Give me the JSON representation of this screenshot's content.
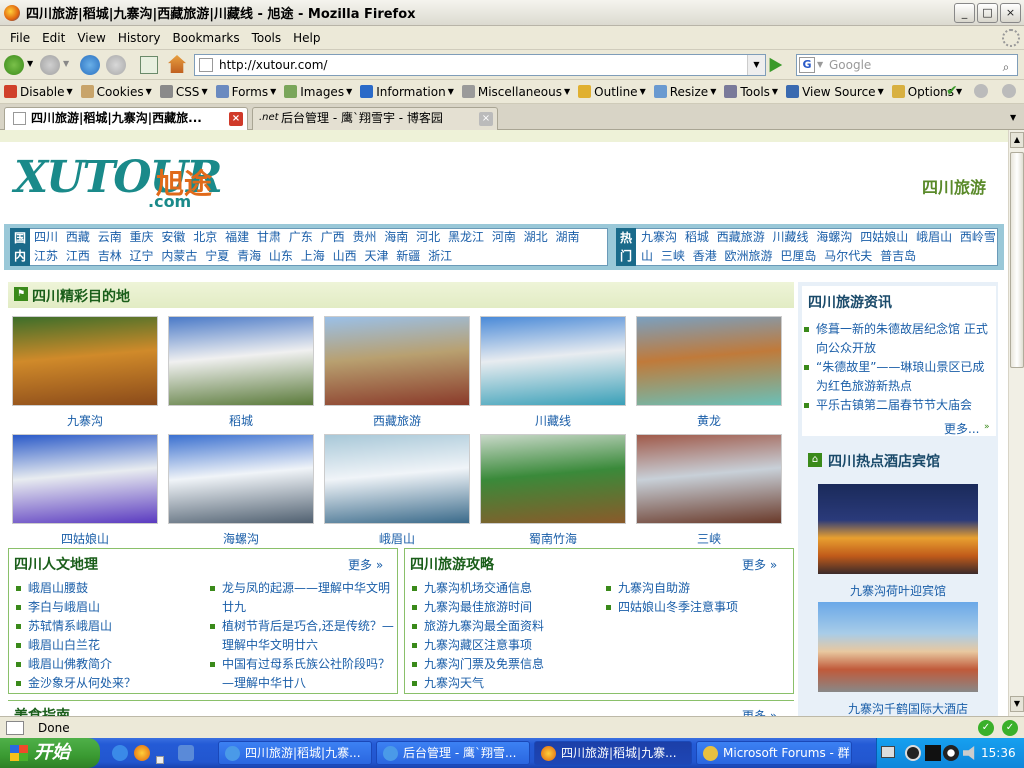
{
  "window": {
    "title": "四川旅游|稻城|九寨沟|西藏旅游|川藏线 - 旭途 - Mozilla Firefox",
    "min": "_",
    "max": "□",
    "close": "×"
  },
  "menu": [
    "File",
    "Edit",
    "View",
    "History",
    "Bookmarks",
    "Tools",
    "Help"
  ],
  "nav": {
    "url": "http://xutour.com/",
    "search_placeholder": "Google"
  },
  "devbar": [
    {
      "label": "Disable",
      "icon": "disable-icon",
      "color": "#d0402a"
    },
    {
      "label": "Cookies",
      "icon": "cookies-icon",
      "color": "#c8a46a"
    },
    {
      "label": "CSS",
      "icon": "css-icon",
      "color": "#8a8a8a"
    },
    {
      "label": "Forms",
      "icon": "forms-icon",
      "color": "#6a8ac0"
    },
    {
      "label": "Images",
      "icon": "images-icon",
      "color": "#7aa65a"
    },
    {
      "label": "Information",
      "icon": "information-icon",
      "color": "#2a6ac8"
    },
    {
      "label": "Miscellaneous",
      "icon": "miscellaneous-icon",
      "color": "#9a9a9a"
    },
    {
      "label": "Outline",
      "icon": "outline-icon",
      "color": "#e0b030"
    },
    {
      "label": "Resize",
      "icon": "resize-icon",
      "color": "#6a9ad0"
    },
    {
      "label": "Tools",
      "icon": "tools-icon",
      "color": "#7a7a9a"
    },
    {
      "label": "View Source",
      "icon": "view-source-icon",
      "color": "#3a6ab0"
    },
    {
      "label": "Options",
      "icon": "options-icon",
      "color": "#d8b040"
    }
  ],
  "tabs": [
    {
      "label": "四川旅游|稻城|九寨沟|西藏旅...",
      "active": true
    },
    {
      "label": "后台管理 - 鹰`翔雪宇 - 博客园",
      "active": false,
      "prefix": ".net"
    }
  ],
  "page": {
    "logo_text": "XUTOUR",
    "logo_cn": "旭途",
    "logo_domain": ".com",
    "header_right": "四川旅游",
    "domestic_label": "国内",
    "domestic_links": [
      "四川",
      "西藏",
      "云南",
      "重庆",
      "安徽",
      "北京",
      "福建",
      "甘肃",
      "广东",
      "广西",
      "贵州",
      "海南",
      "河北",
      "黑龙江",
      "河南",
      "湖北",
      "湖南",
      "江苏",
      "江西",
      "吉林",
      "辽宁",
      "内蒙古",
      "宁夏",
      "青海",
      "山东",
      "上海",
      "山西",
      "天津",
      "新疆",
      "浙江"
    ],
    "hot_label": "热门",
    "hot_links": [
      "九寨沟",
      "稻城",
      "西藏旅游",
      "川藏线",
      "海螺沟",
      "四姑娘山",
      "峨眉山",
      "西岭雪山",
      "三峡",
      "香港",
      "欧洲旅游",
      "巴厘岛",
      "马尔代夫",
      "普吉岛"
    ],
    "destinations_title": "四川精彩目的地",
    "destinations": [
      {
        "name": "九寨沟",
        "colors": [
          "#3c6e2a",
          "#d08a2a",
          "#8a4a1a"
        ]
      },
      {
        "name": "稻城",
        "colors": [
          "#4a7ac8",
          "#f0f0f0",
          "#5a7a3a"
        ]
      },
      {
        "name": "西藏旅游",
        "colors": [
          "#9ac0e8",
          "#b8a070",
          "#8a3a2a"
        ]
      },
      {
        "name": "川藏线",
        "colors": [
          "#4a8ad8",
          "#e8ecf0",
          "#3aa0b8"
        ]
      },
      {
        "name": "黄龙",
        "colors": [
          "#7aa0c0",
          "#c07a3a",
          "#6ac0b8"
        ]
      },
      {
        "name": "四姑娘山",
        "colors": [
          "#2a5ac8",
          "#e8ecf0",
          "#5a3ac0"
        ]
      },
      {
        "name": "海螺沟",
        "colors": [
          "#3a70d0",
          "#f0f4f8",
          "#506070"
        ]
      },
      {
        "name": "峨眉山",
        "colors": [
          "#a8c8d8",
          "#f0f4f8",
          "#3a6a8a"
        ]
      },
      {
        "name": "蜀南竹海",
        "colors": [
          "#c8d8c8",
          "#3a8a3a",
          "#8a5a2a"
        ]
      },
      {
        "name": "三峡",
        "colors": [
          "#a05a4a",
          "#c8d0d8",
          "#6a3a2a"
        ]
      }
    ],
    "news_title": "四川旅游资讯",
    "news": [
      "修葺一新的朱德故居纪念馆 正式向公众开放",
      "“朱德故里”——琳琅山景区已成为红色旅游新热点",
      "平乐古镇第二届春节节大庙会"
    ],
    "news_more": "更多...",
    "hotels_title": "四川热点酒店宾馆",
    "hotels": [
      "九寨沟荷叶迎宾馆",
      "九寨沟千鹤国际大酒店"
    ],
    "culture_title": "四川人文地理",
    "culture_more": "更多 »",
    "culture_left": [
      "峨眉山腰鼓",
      "李白与峨眉山",
      "苏轼情系峨眉山",
      "峨眉山白兰花",
      "峨眉山佛教简介",
      "金沙象牙从何处来？"
    ],
    "culture_right": [
      "龙与凤的起源——理解中华文明廿九",
      "植树节背后是巧合,还是传统？—理解中华文明廿六",
      "中国有过母系氏族公社阶段吗？—理解中华廿八"
    ],
    "guide_title": "四川旅游攻略",
    "guide_more": "更多 »",
    "guide_left": [
      "九寨沟机场交通信息",
      "九寨沟最佳旅游时间",
      "旅游九寨沟最全面资料",
      "九寨沟藏区注意事项",
      "九寨沟门票及免票信息",
      "九寨沟天气"
    ],
    "guide_right": [
      "九寨沟自助游",
      "四姑娘山冬季注意事项"
    ],
    "food_title": "美食指南",
    "food_more": "更多 »"
  },
  "status": "Done",
  "taskbar": {
    "start": "开始",
    "tasks": [
      {
        "label": "四川旅游|稻城|九寨...",
        "active": false
      },
      {
        "label": "后台管理 - 鹰`翔雪...",
        "active": false
      },
      {
        "label": "四川旅游|稻城|九寨...",
        "active": true
      },
      {
        "label": "Microsoft Forums - 群",
        "active": false
      }
    ],
    "clock": "15:36"
  }
}
